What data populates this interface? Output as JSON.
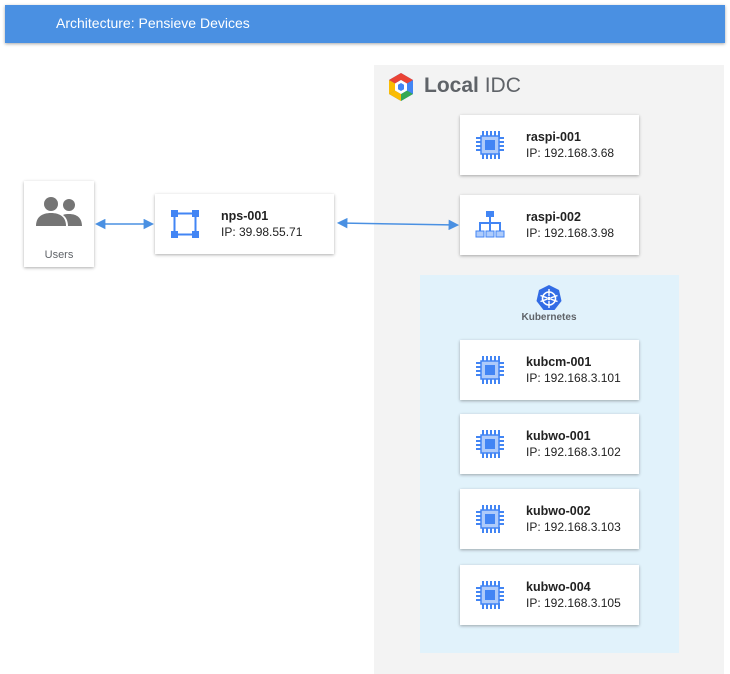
{
  "header": {
    "title": "Architecture: Pensieve Devices"
  },
  "users": {
    "label": "Users",
    "icon": "users-group-icon"
  },
  "nps": {
    "name": "nps-001",
    "ip": "IP: 39.98.55.71",
    "icon": "network-frame-icon"
  },
  "idc": {
    "title_bold": "Local",
    "title_rest": " IDC",
    "logo": "google-cloud-hexagon-icon"
  },
  "raspi": [
    {
      "name": "raspi-001",
      "ip": "IP: 192.168.3.68",
      "icon": "chip-icon"
    },
    {
      "name": "raspi-002",
      "ip": "IP: 192.168.3.98",
      "icon": "hierarchy-icon"
    }
  ],
  "kubernetes": {
    "label": "Kubernetes",
    "icon": "kubernetes-wheel-icon",
    "nodes": [
      {
        "name": "kubcm-001",
        "ip": "IP: 192.168.3.101",
        "icon": "chip-icon"
      },
      {
        "name": "kubwo-001",
        "ip": "IP: 192.168.3.102",
        "icon": "chip-icon"
      },
      {
        "name": "kubwo-002",
        "ip": "IP: 192.168.3.103",
        "icon": "chip-icon"
      },
      {
        "name": "kubwo-004",
        "ip": "IP: 192.168.3.105",
        "icon": "chip-icon"
      }
    ]
  },
  "colors": {
    "header_bg": "#4a90e2",
    "icon_blue": "#4285f4",
    "icon_light_blue": "#aecbfa",
    "connector": "#4a90e2",
    "idc_bg": "#f3f3f3",
    "k8s_bg": "#e1f2fb"
  }
}
